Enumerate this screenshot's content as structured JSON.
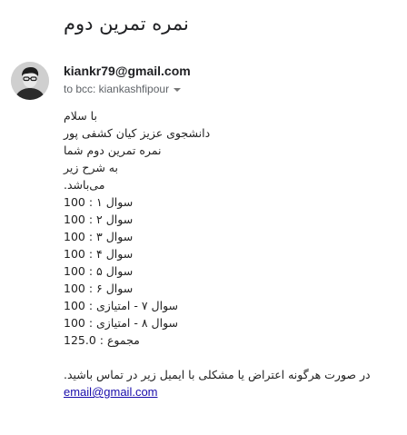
{
  "email": {
    "subject": "نمره تمرین دوم",
    "sender": "kiankr79@gmail.com",
    "recipients": "to bcc: kiankashfipour",
    "body_lines": [
      "با سلام",
      "دانشجوی عزیز کیان کشفی پور",
      "نمره تمرین دوم شما",
      "به شرح زیر",
      "می‌باشد.",
      "سوال ۱ : 100",
      "سوال ۲ : 100",
      "سوال ۳ : 100",
      "سوال ۴ : 100",
      "سوال ۵ : 100",
      "سوال ۶ : 100",
      "سوال ۷ - امتیازی : 100",
      "سوال ۸ - امتیازی : 100",
      "مجموع : 125.0",
      "",
      "در صورت هرگونه اعتراض یا مشکلی با ایمیل زیر در تماس باشید."
    ],
    "contact_link": "email@gmail.com"
  },
  "icons": {
    "avatar": "user-avatar",
    "recipients_toggle": "chevron-down-icon"
  }
}
